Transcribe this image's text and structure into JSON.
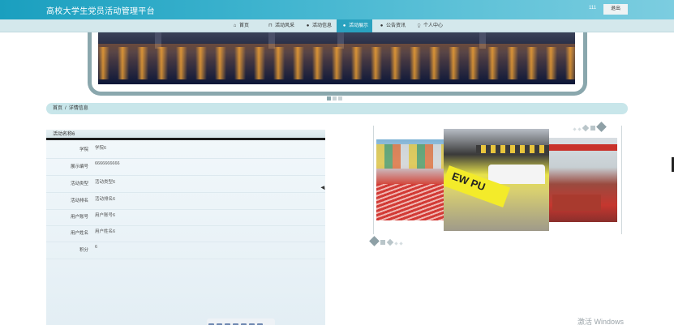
{
  "header": {
    "title": "高校大学生党员活动管理平台",
    "user": "111",
    "logout": "退出"
  },
  "nav": [
    {
      "label": "首页",
      "icon": "home-icon",
      "glyph": "⌂"
    },
    {
      "label": "活动风采",
      "icon": "bag-icon",
      "glyph": "⊓"
    },
    {
      "label": "活动信息",
      "icon": "info-icon",
      "glyph": "●"
    },
    {
      "label": "活动展示",
      "icon": "display-icon",
      "glyph": "●"
    },
    {
      "label": "公告资讯",
      "icon": "notice-icon",
      "glyph": "●"
    },
    {
      "label": "个人中心",
      "icon": "user-icon",
      "glyph": "⍜"
    }
  ],
  "nav_active": "活动展示",
  "breadcrumb": {
    "home": "首页",
    "sep": "/",
    "current": "详情信息"
  },
  "panel": {
    "title": "活动名称6",
    "rows": [
      {
        "label": "学院",
        "value": "学院6"
      },
      {
        "label": "展示编号",
        "value": "6666666666"
      },
      {
        "label": "活动类型",
        "value": "活动类型6"
      },
      {
        "label": "活动排名",
        "value": "活动排名6"
      },
      {
        "label": "用户账号",
        "value": "用户账号6"
      },
      {
        "label": "用户姓名",
        "value": "用户姓名6"
      },
      {
        "label": "积分",
        "value": "6"
      }
    ]
  },
  "gallery": {
    "photo2_text": "EW PU"
  },
  "watermark": "激活 Windows",
  "colors": {
    "header": "#2aa2bf",
    "nav_active": "#2aa2bf",
    "breadcrumb_bg": "#c8e6ea"
  }
}
